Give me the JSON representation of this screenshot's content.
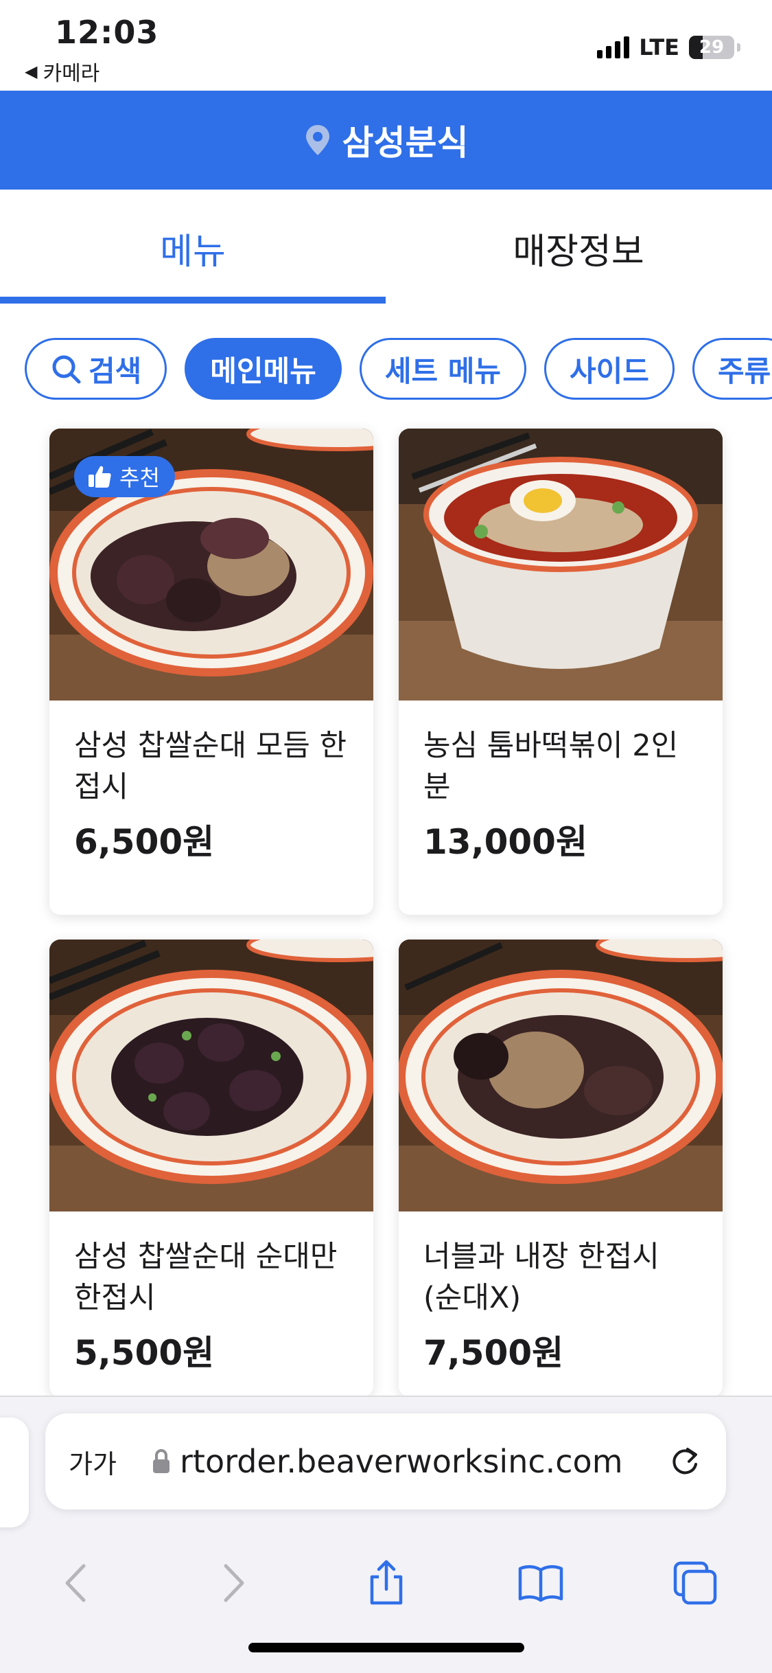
{
  "status_bar": {
    "time": "12:03",
    "back_app": "카메라",
    "network": "LTE",
    "battery": "29"
  },
  "header": {
    "store_name": "삼성분식",
    "pin_icon": "location-pin-icon",
    "accent_color": "#2f6fe8"
  },
  "tabs": [
    {
      "label": "메뉴",
      "active": true
    },
    {
      "label": "매장정보",
      "active": false
    }
  ],
  "chips": [
    {
      "label": "검색",
      "icon": "search-icon"
    },
    {
      "label": "메인메뉴",
      "active": true
    },
    {
      "label": "세트 메뉴"
    },
    {
      "label": "사이드"
    },
    {
      "label": "주류"
    }
  ],
  "menu_items": [
    {
      "name": "삼성 찹쌀순대 모듬 한접시",
      "price": "6,500원",
      "badge": "추천"
    },
    {
      "name": "농심 툼바떡볶이 2인분",
      "price": "13,000원"
    },
    {
      "name": "삼성 찹쌀순대 순대만 한접시",
      "price": "5,500원"
    },
    {
      "name": "너블과 내장 한접시 (순대X)",
      "price": "7,500원"
    }
  ],
  "browser": {
    "aa_label": "가가",
    "url": "rtorder.beaverworksinc.com",
    "toolbar_icons": [
      "back-icon",
      "forward-icon",
      "share-icon",
      "bookmarks-icon",
      "tabs-icon"
    ]
  }
}
